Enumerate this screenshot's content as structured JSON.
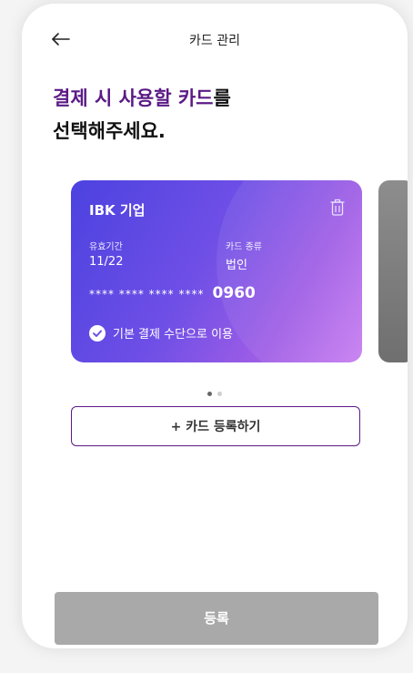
{
  "header": {
    "back_icon": "arrow-left-icon",
    "title": "카드 관리"
  },
  "heading": {
    "accent": "결제 시 사용할 카드",
    "line1_suffix": "를",
    "line2": "선택해주세요."
  },
  "card": {
    "bank": "IBK 기업",
    "delete_icon": "trash-icon",
    "expiry_label": "유효기간",
    "expiry_value": "11/22",
    "type_label": "카드 종류",
    "type_value": "법인",
    "number_mask": "**** **** **** ****",
    "number_last4": "0960",
    "default_icon": "check-circle-icon",
    "default_label": "기본 결제 수단으로 이용",
    "gradient_colors": [
      "#4c42e0",
      "#a05ee6",
      "#c77df0"
    ]
  },
  "pagination": {
    "total": 2,
    "active": 1
  },
  "add_card_button": "+ 카드 등록하기",
  "register_button": "등록",
  "colors": {
    "accent": "#5b1a86",
    "register_button_bg": "#a9a9a9"
  }
}
